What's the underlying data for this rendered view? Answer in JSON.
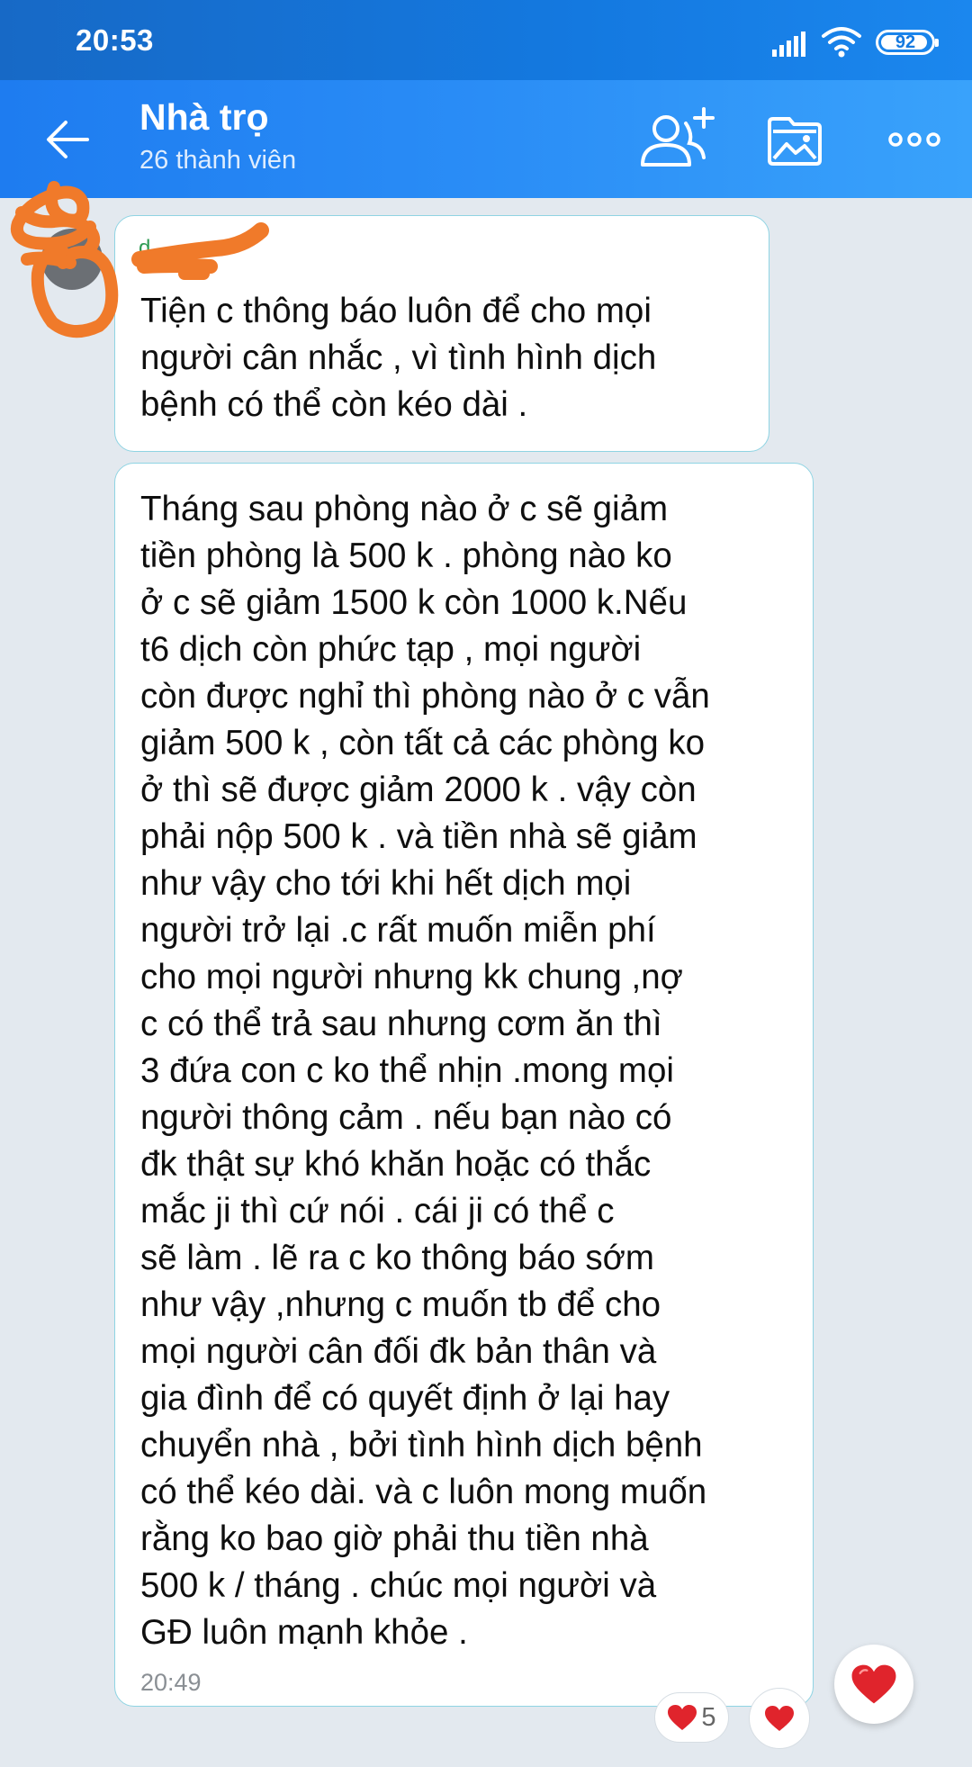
{
  "status_bar": {
    "time": "20:53",
    "battery": "92"
  },
  "header": {
    "title": "Nhà trọ",
    "subtitle": "26 thành viên"
  },
  "messages": [
    {
      "sender": "d",
      "text": "Tiện  c thông báo luôn để cho mọi\nngười cân nhắc , vì tình hình dịch\nbệnh có thể còn kéo dài ."
    },
    {
      "text": "Tháng sau phòng nào ở c sẽ giảm\ntiền phòng là 500 k . phòng nào ko\nở c sẽ giảm 1500 k còn 1000 k.Nếu\nt6 dịch còn phức tạp , mọi người\ncòn được nghỉ thì phòng nào ở c vẫn\ngiảm 500 k , còn tất cả các phòng ko\nở thì sẽ được giảm 2000 k . vậy còn\nphải nộp 500 k . và tiền nhà sẽ giảm\nnhư vậy cho tới khi hết dịch mọi\nngười trở lại .c rất muốn miễn phí\ncho mọi người nhưng kk chung ,nợ\nc có thể trả sau nhưng cơm ăn thì\n3 đứa con c ko thể nhịn .mong mọi\nngười thông cảm . nếu bạn nào có\nđk thật sự khó khăn hoặc có thắc\nmắc ji thì cứ nói . cái ji có thể c\nsẽ làm . lẽ ra c ko thông báo sớm\nnhư vậy ,nhưng c muốn tb để cho\nmọi người cân đối đk bản thân và\ngia đình để có quyết định ở lại hay\nchuyển nhà , bởi tình hình dịch bệnh\ncó thể kéo dài. và c luôn mong muốn\nrằng ko bao giờ phải thu tiền nhà\n500 k / tháng . chúc mọi người và\nGĐ luôn mạnh khỏe .",
      "time": "20:49",
      "reaction_count": "5"
    }
  ],
  "colors": {
    "header_start": "#1e7cf0",
    "header_end": "#39a2fb",
    "bubble_border": "#8fd4e3",
    "background": "#e3e9ef",
    "heart": "#e0242c",
    "scribble": "#f07a2a"
  },
  "icons": [
    "back-arrow-icon",
    "add-member-icon",
    "image-folder-icon",
    "more-dots-icon",
    "heart-icon",
    "signal-icon",
    "wifi-icon",
    "battery-icon"
  ]
}
